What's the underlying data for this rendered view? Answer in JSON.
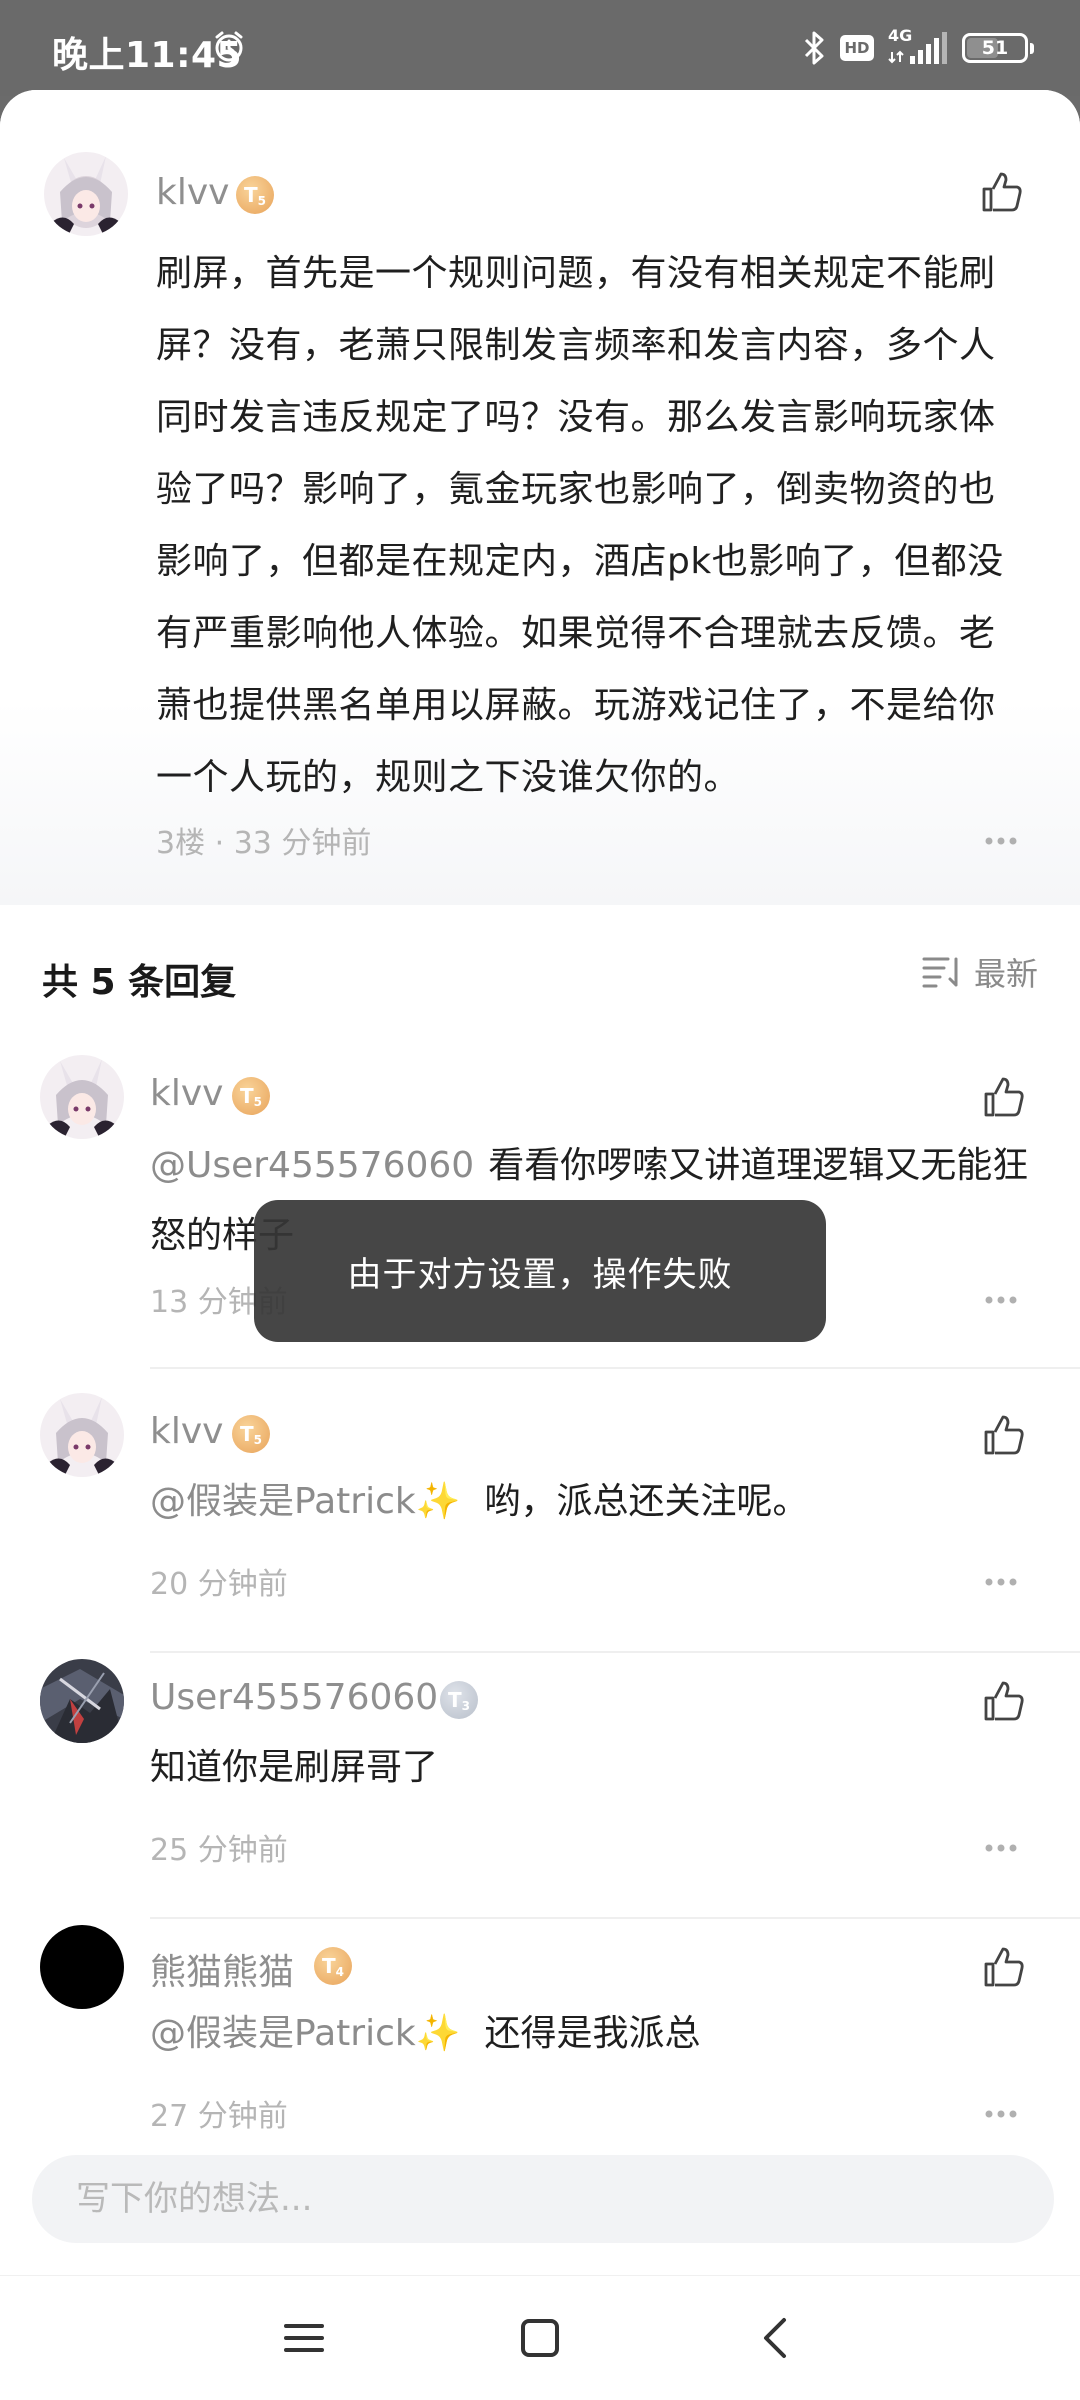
{
  "status_bar": {
    "time": "晚上11:45",
    "battery": "51",
    "network": "4G",
    "hd": "HD"
  },
  "main_comment": {
    "username": "klvv",
    "level": "T",
    "level_num": "5",
    "text": "刷屏，首先是一个规则问题，有没有相关规定不能刷屏？没有，老萧只限制发言频率和发言内容，多个人同时发言违反规定了吗？没有。那么发言影响玩家体验了吗？影响了，氪金玩家也影响了，倒卖物资的也影响了，但都是在规定内，酒店pk也影响了，但都没有严重影响他人体验。如果觉得不合理就去反馈。老萧也提供黑名单用以屏蔽。玩游戏记住了，不是给你一个人玩的，规则之下没谁欠你的。",
    "meta": "3楼 · 33 分钟前"
  },
  "replies_header": {
    "count_label": "共 5 条回复",
    "sort_label": "最新"
  },
  "replies": [
    {
      "username": "klvv",
      "level": "T",
      "level_num": "5",
      "mention": "@User455576060",
      "text": "看看你啰嗦又讲道理逻辑又无能狂怒的样子",
      "time": "13 分钟前"
    },
    {
      "username": "klvv",
      "level": "T",
      "level_num": "5",
      "mention": "@假装是Patrick✨",
      "text": "哟，派总还关注呢。",
      "time": "20 分钟前"
    },
    {
      "username": "User455576060",
      "level": "T",
      "level_num": "3",
      "mention": "",
      "text": "知道你是刷屏哥了",
      "time": "25 分钟前"
    },
    {
      "username": "熊猫熊猫",
      "level": "T",
      "level_num": "4",
      "mention": "@假装是Patrick✨",
      "text": "还得是我派总",
      "time": "27 分钟前"
    }
  ],
  "toast": {
    "message": "由于对方设置，操作失败"
  },
  "input": {
    "placeholder": "写下你的想法..."
  },
  "colors": {
    "accent_orange": "#e8a35a",
    "toast_bg": "#363636",
    "meta_gray": "#b5b5b5"
  }
}
